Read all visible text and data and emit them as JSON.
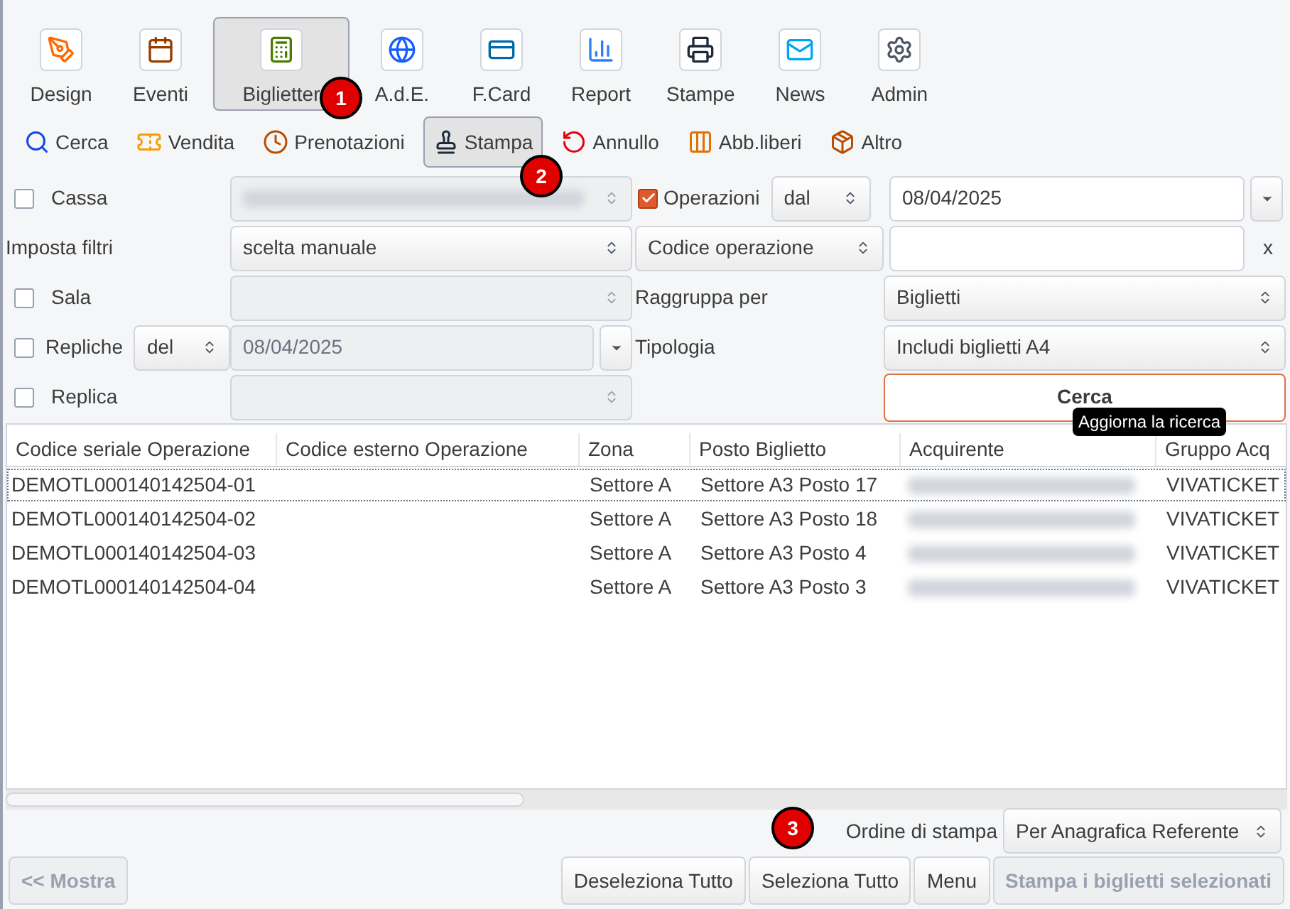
{
  "main_toolbar": [
    {
      "label": "Design",
      "selected": false
    },
    {
      "label": "Eventi",
      "selected": false
    },
    {
      "label": "Biglietter",
      "selected": true
    },
    {
      "label": "A.d.E.",
      "selected": false
    },
    {
      "label": "F.Card",
      "selected": false
    },
    {
      "label": "Report",
      "selected": false
    },
    {
      "label": "Stampe",
      "selected": false
    },
    {
      "label": "News",
      "selected": false
    },
    {
      "label": "Admin",
      "selected": false
    }
  ],
  "sub_toolbar": [
    {
      "label": "Cerca",
      "selected": false
    },
    {
      "label": "Vendita",
      "selected": false
    },
    {
      "label": "Prenotazioni",
      "selected": false
    },
    {
      "label": "Stampa",
      "selected": true
    },
    {
      "label": "Annullo",
      "selected": false
    },
    {
      "label": "Abb.liberi",
      "selected": false
    },
    {
      "label": "Altro",
      "selected": false
    }
  ],
  "badges": [
    "1",
    "2",
    "3"
  ],
  "filters": {
    "cassa": {
      "label": "Cassa",
      "checked": false
    },
    "operazioni": {
      "label": "Operazioni",
      "checked": true,
      "mode": "dal",
      "date": "08/04/2025"
    },
    "imposta_filtri": {
      "label": "Imposta filtri",
      "value": "scelta manuale"
    },
    "codice": {
      "value": "Codice operazione",
      "clear": "x"
    },
    "sala": {
      "label": "Sala",
      "checked": false
    },
    "raggruppa": {
      "label": "Raggruppa per",
      "value": "Biglietti"
    },
    "repliche": {
      "label": "Repliche",
      "checked": false,
      "mode": "del",
      "date": "08/04/2025"
    },
    "tipologia": {
      "label": "Tipologia",
      "value": "Includi biglietti A4"
    },
    "replica": {
      "label": "Replica",
      "checked": false
    },
    "search_button": "Cerca",
    "tooltip": "Aggiorna la ricerca"
  },
  "table": {
    "columns": [
      "Codice seriale Operazione",
      "Codice esterno Operazione",
      "Zona",
      "Posto Biglietto",
      "Acquirente",
      "Gruppo Acq"
    ],
    "rows": [
      {
        "cells": [
          "DEMOTL000140142504-01",
          "",
          "Settore A",
          "Settore A3 Posto 17",
          "",
          "VIVATICKET"
        ],
        "focused": true
      },
      {
        "cells": [
          "DEMOTL000140142504-02",
          "",
          "Settore A",
          "Settore A3 Posto 18",
          "",
          "VIVATICKET"
        ],
        "focused": false
      },
      {
        "cells": [
          "DEMOTL000140142504-03",
          "",
          "Settore A",
          "Settore A3 Posto 4",
          "",
          "VIVATICKET"
        ],
        "focused": false
      },
      {
        "cells": [
          "DEMOTL000140142504-04",
          "",
          "Settore A",
          "Settore A3 Posto 3",
          "",
          "VIVATICKET"
        ],
        "focused": false
      }
    ]
  },
  "print_order": {
    "label": "Ordine di stampa",
    "value": "Per Anagrafica Referente"
  },
  "footer_buttons": [
    {
      "label": "<< Mostra",
      "disabled": true
    },
    {
      "label": "Deseleziona Tutto",
      "disabled": false
    },
    {
      "label": "Seleziona Tutto",
      "disabled": false
    },
    {
      "label": "Menu",
      "disabled": false
    },
    {
      "label": "Stampa i biglietti selezionati",
      "disabled": true
    }
  ]
}
